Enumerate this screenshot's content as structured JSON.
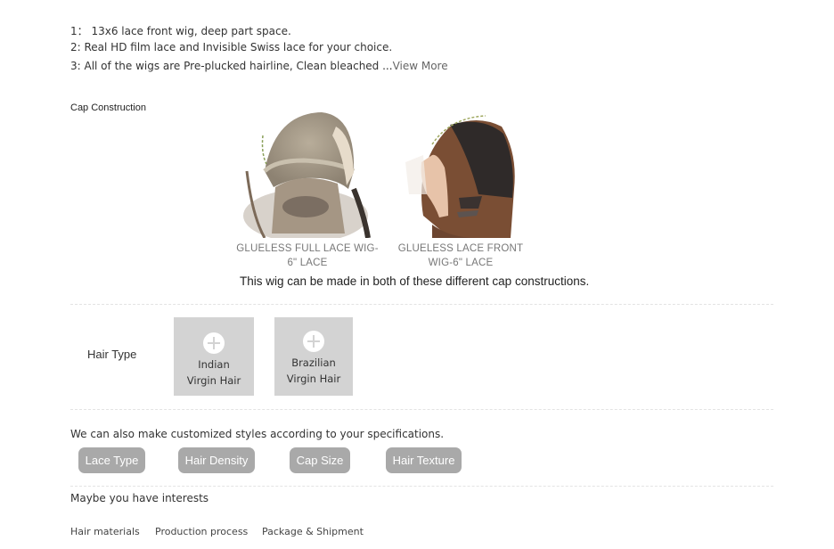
{
  "features": {
    "line1": "1：  13x6 lace front wig, deep part space.",
    "line2": "2: Real HD film lace and Invisible Swiss lace for your choice.",
    "line3": "3: All of the wigs are Pre-plucked hairline, Clean bleached ...",
    "view_more": "View More"
  },
  "cap_construction": {
    "title": "Cap Construction",
    "options": [
      {
        "label": "GLUELESS FULL LACE WIG-6\" LACE",
        "image_icon": "full-lace-cap-photo"
      },
      {
        "label": "GLUELESS LACE FRONT WIG-6\" LACE",
        "image_icon": "lace-front-cap-photo"
      }
    ],
    "note": "This wig can be made in both of these different cap constructions."
  },
  "hair_type": {
    "label": "Hair Type",
    "options": [
      {
        "line1": "Indian",
        "line2": "Virgin Hair",
        "icon": "plus-icon"
      },
      {
        "line1": "Brazilian",
        "line2": "Virgin Hair",
        "icon": "plus-icon"
      }
    ]
  },
  "customize": {
    "text": "We can also make customized styles according to your specifications.",
    "buttons": [
      "Lace Type",
      "Hair Density",
      "Cap Size",
      "Hair Texture"
    ],
    "button_color": "#a9a9a9"
  },
  "interests": {
    "title": "Maybe you have interests",
    "links": [
      "Hair materials",
      "Production process",
      "Package & Shipment"
    ]
  }
}
